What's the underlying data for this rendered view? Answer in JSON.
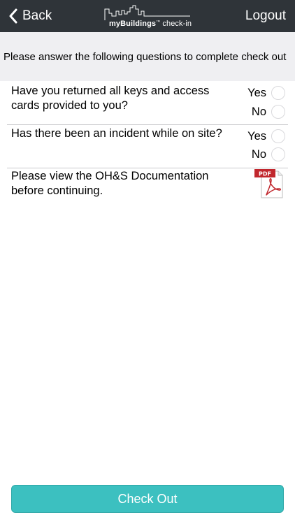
{
  "nav": {
    "back_label": "Back",
    "logout_label": "Logout",
    "logo": {
      "brand": "myBuildings",
      "tm": "™",
      "suffix": " check-in"
    }
  },
  "intro": "Please answer the following questions to complete check out",
  "questions": [
    {
      "text": "Have you returned all keys and access cards provided to you?",
      "yes": "Yes",
      "no": "No"
    },
    {
      "text": "Has there been an incident while on site?",
      "yes": "Yes",
      "no": "No"
    }
  ],
  "ohs": {
    "text": "Please view the OH&S Documentation before continuing.",
    "pdf_label": "PDF",
    "icon": "pdf-document-icon"
  },
  "checkout_label": "Check Out",
  "colors": {
    "navbar": "#2f3439",
    "intro_bg": "#efeff2",
    "button": "#3cc0c0",
    "pdf_red": "#c1272d"
  }
}
